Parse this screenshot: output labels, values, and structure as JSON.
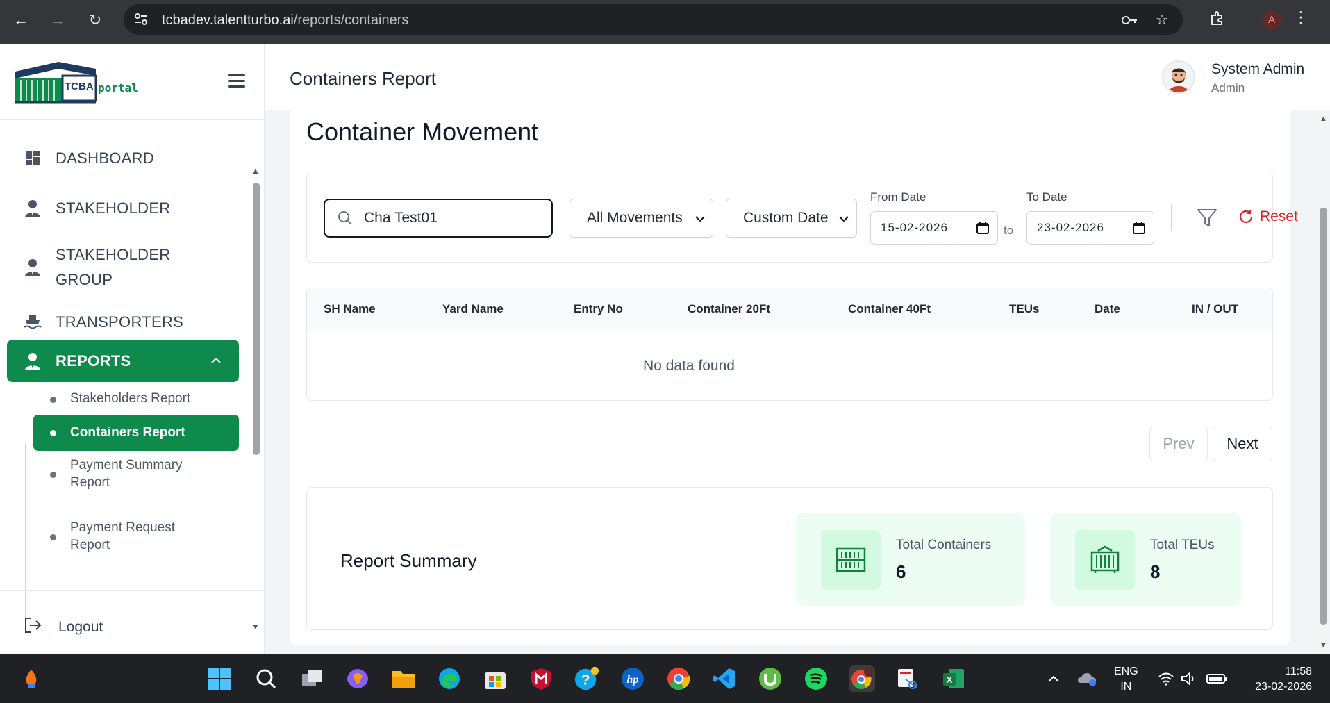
{
  "browser": {
    "url_host": "tcbadev.talentturbo.ai",
    "url_path": "/reports/containers",
    "profile_initial": "A"
  },
  "sidebar": {
    "logo_text": "TCBA",
    "logo_subtext": "portal",
    "items": [
      {
        "label": "DASHBOARD",
        "icon": "dashboard-icon"
      },
      {
        "label": "STAKEHOLDER",
        "icon": "user-icon"
      },
      {
        "label": "STAKEHOLDER",
        "label2": "GROUP",
        "icon": "user-group-icon"
      },
      {
        "label": "TRANSPORTERS",
        "icon": "ship-icon"
      },
      {
        "label": "REPORTS",
        "icon": "user-icon",
        "active": true
      }
    ],
    "subitems": [
      {
        "label": "Stakeholders Report"
      },
      {
        "label": "Containers Report",
        "active": true
      },
      {
        "label": "Payment Summary",
        "label2": "Report"
      },
      {
        "label": "Payment Request",
        "label2": "Report"
      }
    ],
    "logout_label": "Logout"
  },
  "header": {
    "title": "Containers Report",
    "user_name": "System Admin",
    "user_role": "Admin"
  },
  "main": {
    "section_title": "Container Movement",
    "filters": {
      "search_value": "Cha Test01",
      "movement_selected": "All Movements",
      "date_mode_selected": "Custom Date",
      "from_label": "From Date",
      "from_value": "15-02-2026",
      "to_word": "to",
      "to_label": "To Date",
      "to_value": "23-02-2026",
      "reset_label": "Reset"
    },
    "table": {
      "columns": [
        "SH Name",
        "Yard Name",
        "Entry No",
        "Container 20Ft",
        "Container 40Ft",
        "TEUs",
        "Date",
        "IN / OUT"
      ],
      "rows": [],
      "empty_text": "No data found"
    },
    "pager": {
      "prev_label": "Prev",
      "next_label": "Next"
    },
    "summary": {
      "title": "Report Summary",
      "stats": [
        {
          "label": "Total Containers",
          "value": "6"
        },
        {
          "label": "Total TEUs",
          "value": "8"
        }
      ]
    }
  },
  "taskbar": {
    "lang_line1": "ENG",
    "lang_line2": "IN",
    "time": "11:58",
    "date": "23-02-2026"
  },
  "colors": {
    "brand_green": "#0e8a4d",
    "danger": "#dc2626",
    "stat_bg": "#ecfdf3"
  }
}
